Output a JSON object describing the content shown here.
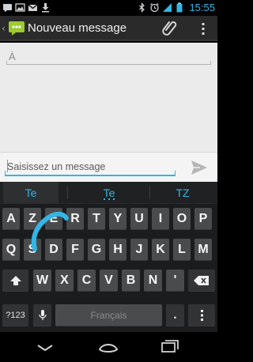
{
  "status_bar": {
    "time": "15:55",
    "left_icons": [
      "message-notification-icon",
      "image-icon",
      "gmail-icon",
      "download-icon"
    ],
    "right_icons": [
      "bluetooth-icon",
      "alarm-icon",
      "signal-icon",
      "battery-icon"
    ]
  },
  "action_bar": {
    "title": "Nouveau message",
    "icons": [
      "back-chevron-icon",
      "messaging-app-icon",
      "paperclip-icon",
      "overflow-menu-icon"
    ]
  },
  "compose": {
    "to_placeholder": "À",
    "message_placeholder": "Saisissez un message"
  },
  "keyboard": {
    "suggestions": [
      "Te",
      "Te",
      "TZ"
    ],
    "row1": [
      "A",
      "Z",
      "E",
      "R",
      "T",
      "Y",
      "U",
      "I",
      "O",
      "P"
    ],
    "row2": [
      "Q",
      "S",
      "D",
      "F",
      "G",
      "H",
      "J",
      "K",
      "L",
      "M"
    ],
    "row3": [
      "W",
      "X",
      "C",
      "V",
      "B",
      "N",
      "'"
    ],
    "symbols_key": "?123",
    "space_label": "Français",
    "period_key": ".",
    "colors": {
      "accent": "#33b5e5",
      "key": "#4a4b4d",
      "key_dark": "#323334"
    }
  },
  "nav_bar": {
    "icons": [
      "back-icon",
      "home-icon",
      "recent-apps-icon"
    ]
  }
}
